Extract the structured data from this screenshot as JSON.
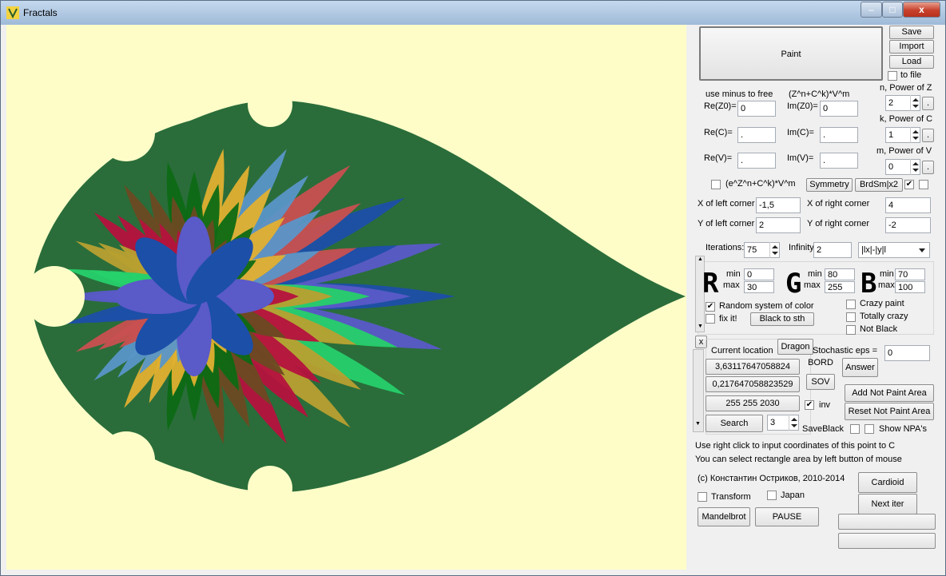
{
  "window": {
    "title": "Fractals",
    "min": "–",
    "max": "□",
    "close": "x"
  },
  "main": {
    "paint": "Paint",
    "save": "Save",
    "import": "Import",
    "load": "Load",
    "to_file": "to file",
    "formula_hint": "use minus to free",
    "formula": "(Z^n+C^k)*V^m",
    "re_z0": "Re(Z0)=",
    "re_z0_val": "0",
    "im_z0": "Im(Z0)=",
    "im_z0_val": "0",
    "re_c": "Re(C)=",
    "re_c_val": ".",
    "im_c": "Im(C)=",
    "im_c_val": ".",
    "re_v": "Re(V)=",
    "re_v_val": ".",
    "im_v": "Im(V)=",
    "im_v_val": ".",
    "power_z": "n, Power of Z",
    "power_z_val": "2",
    "power_c": "k, Power of C",
    "power_c_val": "1",
    "power_v": "m, Power of V",
    "power_v_val": "0",
    "dot": ".",
    "exp_formula": "(e^Z^n+C^k)*V^m",
    "symmetry": "Symmetry",
    "brdsm": "BrdSm|x2",
    "x_left": "X of left corner",
    "x_left_val": "-1,5",
    "x_right": "X of right corner",
    "x_right_val": "4",
    "y_left": "Y of left corner",
    "y_left_val": "2",
    "y_right": "Y of right corner",
    "y_right_val": "-2",
    "iterations": "Iterations:",
    "iterations_val": "75",
    "infinity": "Infinity:",
    "infinity_val": "2",
    "norm": "|lx|-|y|l"
  },
  "colors": {
    "r": "R",
    "g": "G",
    "b": "B",
    "min": "min",
    "max": "max",
    "r_min": "0",
    "r_max": "30",
    "g_min": "80",
    "g_max": "255",
    "b_min": "70",
    "b_max": "100",
    "random": "Random system of color",
    "fix": "fix it!",
    "black_to": "Black to sth",
    "crazy": "Crazy paint",
    "totally": "Totally crazy",
    "not_black": "Not Black"
  },
  "location": {
    "x_btn": "x",
    "current": "Current location",
    "dragon": "Dragon",
    "stoch": "Stochastic eps =",
    "stoch_val": "0",
    "coord1": "3,63117647058824",
    "bord": "BORD",
    "answer": "Answer",
    "coord2": "0,217647058823529",
    "sov": "SOV",
    "rgb": "255 255 2030",
    "inv": "inv",
    "add_npa": "Add Not Paint Area",
    "reset_npa": "Reset Not Paint Area",
    "search": "Search",
    "search_val": "3",
    "saveblack": "SaveBlack",
    "show_npa": "Show NPA's",
    "hint1": "Use right click to input coordinates of this point to C",
    "hint2": "You can select rectangle area by left button of mouse",
    "copyright": "(c) Константин Остриков, 2010-2014",
    "cardioid": "Cardioid",
    "transform": "Transform",
    "japan": "Japan",
    "next_iter": "Next iter",
    "mandelbrot": "Mandelbrot",
    "pause": "PAUSE"
  },
  "palette": [
    "#1c4fa8",
    "#5a5ac8",
    "#26d06a",
    "#b8a030",
    "#b5123e",
    "#6b4a22",
    "#0d6a14",
    "#e0b030",
    "#5a96c8",
    "#c85050"
  ]
}
